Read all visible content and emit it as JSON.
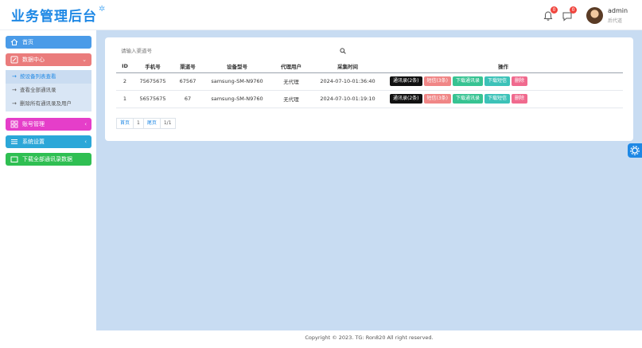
{
  "app": {
    "logo": "业务管理后台",
    "logo_mark": "✲"
  },
  "header": {
    "notification_badge": "0",
    "message_badge": "0",
    "user_name": "admin",
    "user_role": "后代道"
  },
  "sidebar": {
    "home": "首页",
    "data_center": "数据中心",
    "sub_items": [
      "按设备列表查看",
      "查看全部通讯录",
      "删除所有通讯录及用户"
    ],
    "account_mgmt": "账号管理",
    "system_settings": "系统设置",
    "download_all": "下载全部通讯录数据",
    "colors": {
      "home": "#4a9be8",
      "data_center": "#ea7c7c",
      "account": "#e53ec9",
      "system": "#2ba7d8",
      "download": "#2fbf52"
    }
  },
  "search": {
    "placeholder": "请输入渠道号"
  },
  "table": {
    "headers": [
      "ID",
      "手机号",
      "渠道号",
      "设备型号",
      "代理用户",
      "采集时间",
      "操作"
    ],
    "rows": [
      {
        "id": "2",
        "phone": "75675675",
        "channel": "67567",
        "device": "samsung-SM-N9760",
        "agent": "无代理",
        "time": "2024-07-10-01:36:40",
        "actions": [
          "通讯录(2条)",
          "短信(3条)",
          "下载通讯录",
          "下载短信",
          "删除"
        ]
      },
      {
        "id": "1",
        "phone": "56575675",
        "channel": "67",
        "device": "samsung-SM-N9760",
        "agent": "无代理",
        "time": "2024-07-10-01:19:10",
        "actions": [
          "通讯录(2条)",
          "短信(3条)",
          "下载通讯录",
          "下载短信",
          "删除"
        ]
      }
    ]
  },
  "pager": {
    "first": "首页",
    "page": "1",
    "last": "尾页",
    "count": "1/1"
  },
  "footer": {
    "text": "Copyright © 2023. TG: Ron820 All right reserved."
  }
}
